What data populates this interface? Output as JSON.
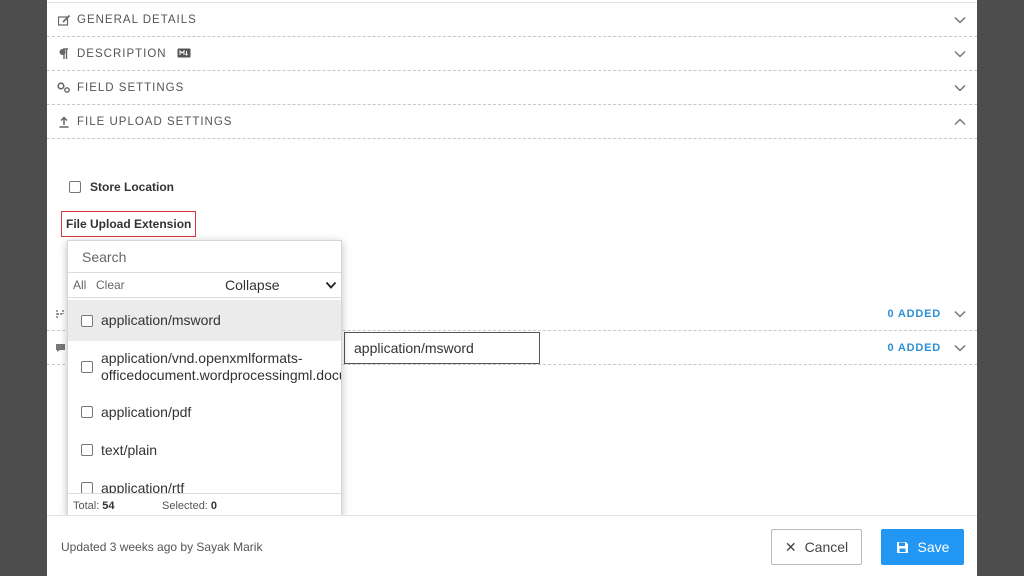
{
  "sections": [
    {
      "title": "GENERAL DETAILS",
      "icon": "edit-icon",
      "state": "collapsed"
    },
    {
      "title": "DESCRIPTION",
      "icon": "paragraph-icon",
      "badge_icon": "markdown-badge-icon",
      "state": "collapsed"
    },
    {
      "title": "FIELD SETTINGS",
      "icon": "cogs-icon",
      "state": "collapsed"
    },
    {
      "title": "FILE UPLOAD SETTINGS",
      "icon": "upload-icon",
      "state": "expanded"
    }
  ],
  "file_upload": {
    "store_location_label": "Store Location",
    "store_location_checked": false,
    "extension_label": "File Upload Extension"
  },
  "extension_dropdown": {
    "search_placeholder": "Search",
    "all_label": "All",
    "clear_label": "Clear",
    "collapse_label": "Collapse",
    "options": [
      {
        "line1": "application/msword",
        "checked": false
      },
      {
        "line1": "application/vnd.openxmlformats-",
        "line2": "officedocument.wordprocessingml.document",
        "checked": false
      },
      {
        "line1": "application/pdf",
        "checked": false
      },
      {
        "line1": "text/plain",
        "checked": false
      },
      {
        "line1": "application/rtf",
        "checked": false
      }
    ],
    "total_label": "Total:",
    "total_value": "54",
    "selected_label": "Selected:",
    "selected_value": "0"
  },
  "tooltip_text": "application/msword",
  "lower_rows": [
    {
      "added_text": "0 ADDED"
    },
    {
      "added_text": "0 ADDED"
    }
  ],
  "footer": {
    "updated_text": "Updated 3 weeks ago by Sayak Marik",
    "cancel_label": "Cancel",
    "save_label": "Save"
  },
  "colors": {
    "accent": "#2196f3",
    "added_text": "#2d8fd5",
    "highlight_border": "#d9363e",
    "backdrop": "#4d4d4d"
  }
}
